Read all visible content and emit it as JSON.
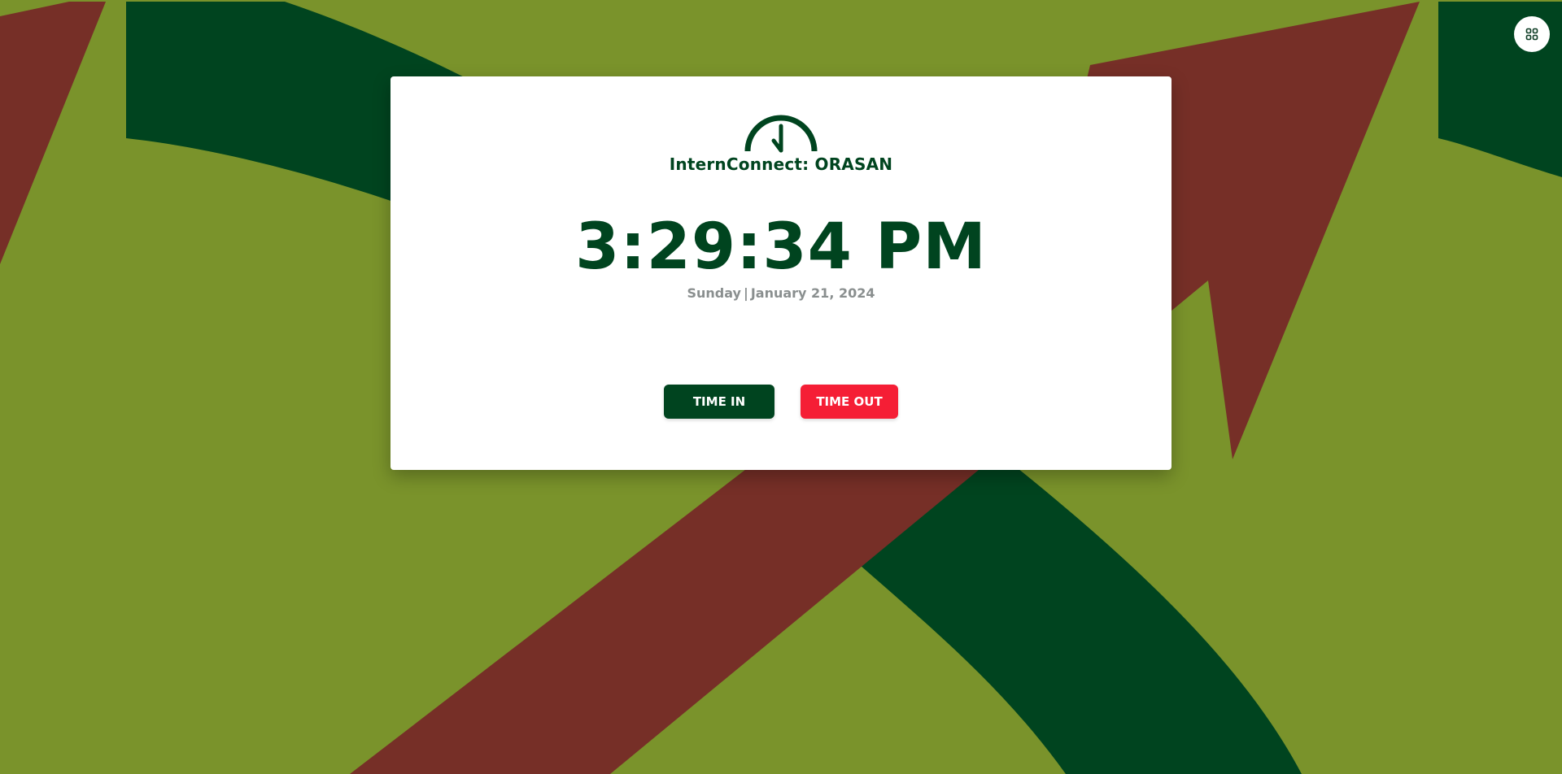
{
  "app": {
    "title": "InternConnect: ORASAN",
    "logo_icon": "clock-icon"
  },
  "clock": {
    "time": "3:29:34 PM",
    "day": "Sunday",
    "separator": "|",
    "date": "January 21, 2024"
  },
  "actions": {
    "time_in_label": "TIME IN",
    "time_out_label": "TIME OUT"
  },
  "menu": {
    "icon": "grid-icon"
  },
  "colors": {
    "brand_green": "#00441f",
    "time_out_red": "#f51e35",
    "background_olive": "#7a932b",
    "background_maroon": "#762f27",
    "date_gray": "#8a8f8f"
  }
}
